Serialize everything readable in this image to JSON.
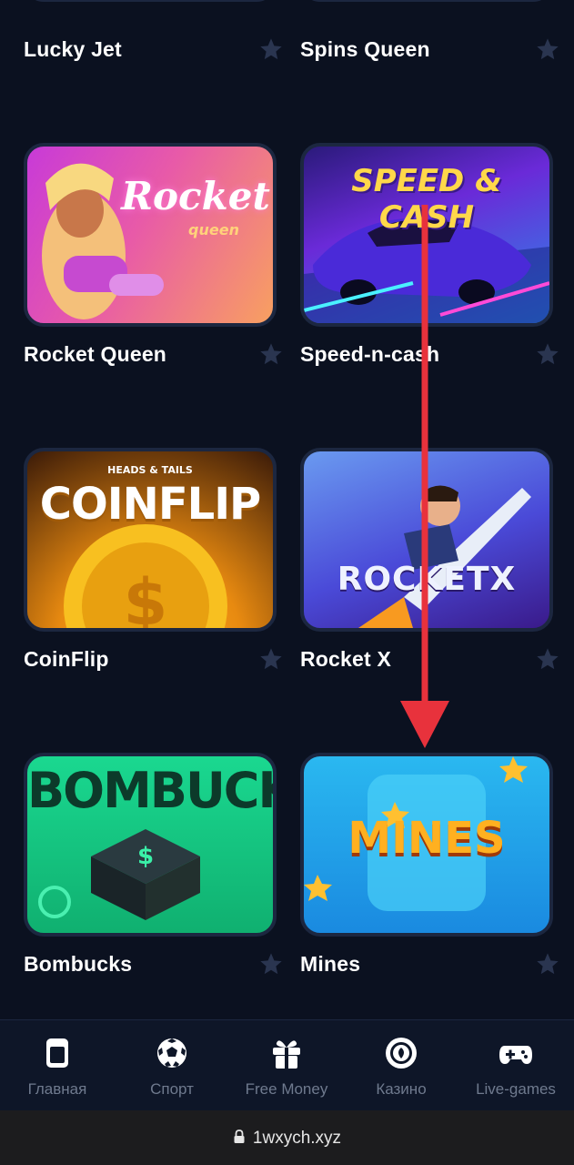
{
  "games": [
    {
      "title": "Lucky Jet"
    },
    {
      "title": "Spins Queen"
    },
    {
      "title": "Rocket Queen",
      "art_text": "Rocket",
      "art_sub": "queen"
    },
    {
      "title": "Speed-n-cash",
      "art_text": "SPEED & CASH"
    },
    {
      "title": "CoinFlip",
      "art_sub": "HEADS & TAILS",
      "art_text": "COINFLIP"
    },
    {
      "title": "Rocket X",
      "art_text": "ROCKETX"
    },
    {
      "title": "Bombucks",
      "art_text": "BOMBUCKS"
    },
    {
      "title": "Mines",
      "art_text": "MINES"
    }
  ],
  "nav": {
    "items": [
      {
        "label": "Главная",
        "icon": "home-icon"
      },
      {
        "label": "Спорт",
        "icon": "soccer-ball-icon"
      },
      {
        "label": "Free Money",
        "icon": "gift-icon"
      },
      {
        "label": "Казино",
        "icon": "casino-chip-icon"
      },
      {
        "label": "Live-games",
        "icon": "gamepad-icon"
      }
    ]
  },
  "browser": {
    "url": "1wxych.xyz"
  },
  "colors": {
    "background": "#0b1120",
    "nav_label": "#6f7a8e",
    "star": "#2a3550",
    "arrow": "#e8323c"
  }
}
